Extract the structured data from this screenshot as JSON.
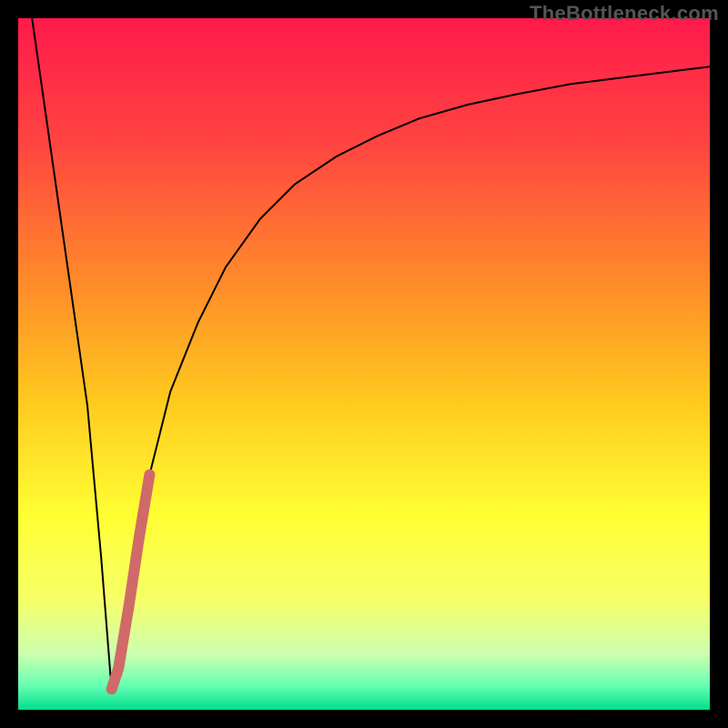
{
  "watermark": "TheBottleneck.com",
  "colors": {
    "frame": "#000000",
    "watermark": "#555555",
    "curve": "#000000",
    "highlight": "#cf6a68",
    "gradient_stops": [
      {
        "offset": 0.0,
        "color": "#ff1a4b"
      },
      {
        "offset": 0.18,
        "color": "#ff4440"
      },
      {
        "offset": 0.38,
        "color": "#ff8a2a"
      },
      {
        "offset": 0.55,
        "color": "#ffc81e"
      },
      {
        "offset": 0.72,
        "color": "#ffff33"
      },
      {
        "offset": 0.84,
        "color": "#f6ff66"
      },
      {
        "offset": 0.92,
        "color": "#ccffb0"
      },
      {
        "offset": 0.965,
        "color": "#66ffb3"
      },
      {
        "offset": 1.0,
        "color": "#00e08a"
      }
    ]
  },
  "chart_data": {
    "type": "line",
    "title": "",
    "xlabel": "",
    "ylabel": "",
    "xlim": [
      0,
      100
    ],
    "ylim": [
      0,
      100
    ],
    "grid": false,
    "legend": false,
    "series": [
      {
        "name": "bottleneck-curve",
        "x": [
          2,
          4,
          6,
          8,
          10,
          12,
          13.5,
          15,
          17,
          19,
          22,
          26,
          30,
          35,
          40,
          46,
          52,
          58,
          65,
          72,
          80,
          88,
          96,
          100
        ],
        "y": [
          100,
          86,
          72,
          58,
          44,
          22,
          3,
          8,
          22,
          34,
          46,
          56,
          64,
          71,
          76,
          80,
          83,
          85.5,
          87.5,
          89,
          90.5,
          91.5,
          92.5,
          93
        ]
      },
      {
        "name": "highlight-segment",
        "x": [
          13.5,
          14.5,
          16,
          17.5,
          19
        ],
        "y": [
          3,
          6,
          15,
          25,
          34
        ]
      }
    ],
    "minimum": {
      "x": 13.5,
      "y": 3
    }
  }
}
